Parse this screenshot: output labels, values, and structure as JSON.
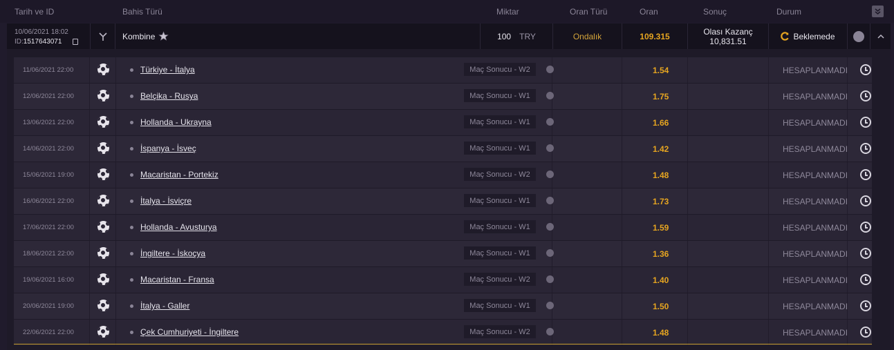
{
  "header": {
    "date_id": "Tarih ve ID",
    "bet_type": "Bahis Türü",
    "amount": "Miktar",
    "odds_type": "Oran Türü",
    "odds": "Oran",
    "result": "Sonuç",
    "status": "Durum"
  },
  "bet": {
    "date": "10/06/2021 18:02",
    "id_label": "ID:",
    "id": "1517643071",
    "type": "Kombine",
    "amount": "100",
    "currency": "TRY",
    "odds_type": "Ondalık",
    "odds": "109.315",
    "possible_win_label": "Olası Kazanç",
    "possible_win": "10,831.51",
    "status": "Beklemede"
  },
  "colors": {
    "accent": "#e6a520",
    "background": "#201b2c"
  },
  "selections": [
    {
      "date": "11/06/2021 22:00",
      "match": "Türkiye - İtalya",
      "market": "Maç Sonucu - W2",
      "odds": "1.54",
      "result": "HESAPLANMADI"
    },
    {
      "date": "12/06/2021 22:00",
      "match": "Belçika - Rusya",
      "market": "Maç Sonucu - W1",
      "odds": "1.75",
      "result": "HESAPLANMADI"
    },
    {
      "date": "13/06/2021 22:00",
      "match": "Hollanda - Ukrayna",
      "market": "Maç Sonucu - W1",
      "odds": "1.66",
      "result": "HESAPLANMADI"
    },
    {
      "date": "14/06/2021 22:00",
      "match": "İspanya - İsveç",
      "market": "Maç Sonucu - W1",
      "odds": "1.42",
      "result": "HESAPLANMADI"
    },
    {
      "date": "15/06/2021 19:00",
      "match": "Macaristan - Portekiz",
      "market": "Maç Sonucu - W2",
      "odds": "1.48",
      "result": "HESAPLANMADI"
    },
    {
      "date": "16/06/2021 22:00",
      "match": "İtalya - İsviçre",
      "market": "Maç Sonucu - W1",
      "odds": "1.73",
      "result": "HESAPLANMADI"
    },
    {
      "date": "17/06/2021 22:00",
      "match": "Hollanda - Avusturya",
      "market": "Maç Sonucu - W1",
      "odds": "1.59",
      "result": "HESAPLANMADI"
    },
    {
      "date": "18/06/2021 22:00",
      "match": "İngiltere - İskoçya",
      "market": "Maç Sonucu - W1",
      "odds": "1.36",
      "result": "HESAPLANMADI"
    },
    {
      "date": "19/06/2021 16:00",
      "match": "Macaristan - Fransa",
      "market": "Maç Sonucu - W2",
      "odds": "1.40",
      "result": "HESAPLANMADI"
    },
    {
      "date": "20/06/2021 19:00",
      "match": "İtalya - Galler",
      "market": "Maç Sonucu - W1",
      "odds": "1.50",
      "result": "HESAPLANMADI"
    },
    {
      "date": "22/06/2021 22:00",
      "match": "Çek Cumhuriyeti - İngiltere",
      "market": "Maç Sonucu - W2",
      "odds": "1.48",
      "result": "HESAPLANMADI"
    }
  ]
}
